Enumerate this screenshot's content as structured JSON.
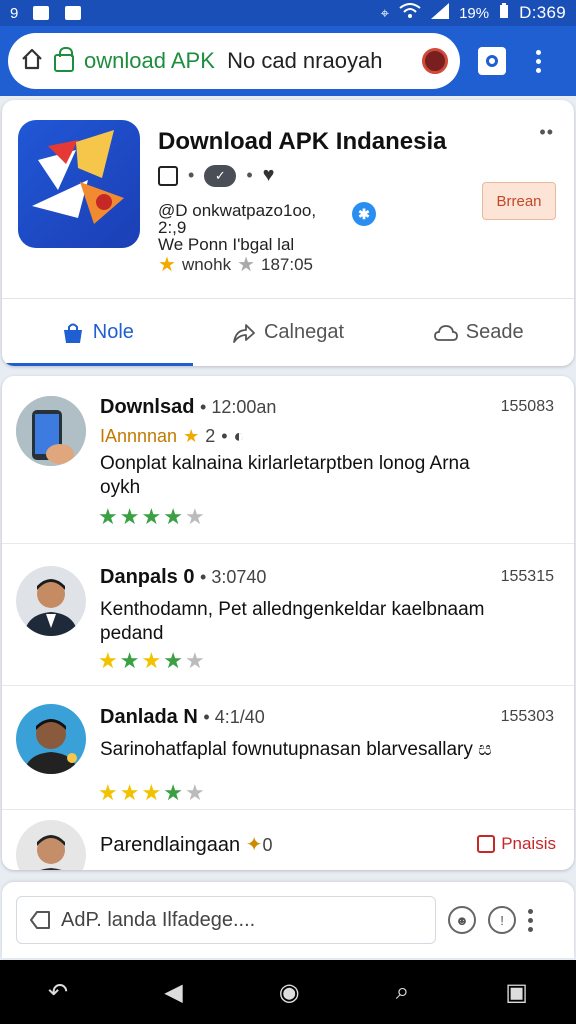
{
  "status_bar": {
    "left_icon1": "9",
    "signal": "19%",
    "clock": "D:369"
  },
  "browser": {
    "url_green": "ownload APK",
    "url_rest": "No cad nraoyah"
  },
  "app": {
    "title": "Download APK Indanesia",
    "more": "••",
    "meta_line1": "@D onkwatpazo1oo, 2:,9",
    "meta_line2": "We Ponn I'bgal lal",
    "rating_label": "wnohk",
    "rating_value": "187:05",
    "install_label": "Brrean"
  },
  "tabs": [
    {
      "label": "Nole"
    },
    {
      "label": "Calnegat"
    },
    {
      "label": "Seade"
    }
  ],
  "reviews": [
    {
      "name": "Downlsad",
      "time": "12:00an",
      "count": "155083",
      "sub": "IAnnnnan",
      "sub_num": "2",
      "text": "Oonplat kalnaina kirlarletarptben lonog Arna oykh"
    },
    {
      "name": "Danpals 0",
      "time": "3:0740",
      "count": "155315",
      "text": "Kenthodamn, Pet alledngenkeldar kaelbnaam pedand"
    },
    {
      "name": "Danlada N",
      "time": "4:1/40",
      "count": "155303",
      "text": "Sarinohatfaplal fownutupnasan blarvesallary ස"
    },
    {
      "name": "Parendlaingaan",
      "time": "0",
      "report_label": "Pnaisis"
    }
  ],
  "comment": {
    "placeholder": "AdP. landa Ilfadege...."
  }
}
